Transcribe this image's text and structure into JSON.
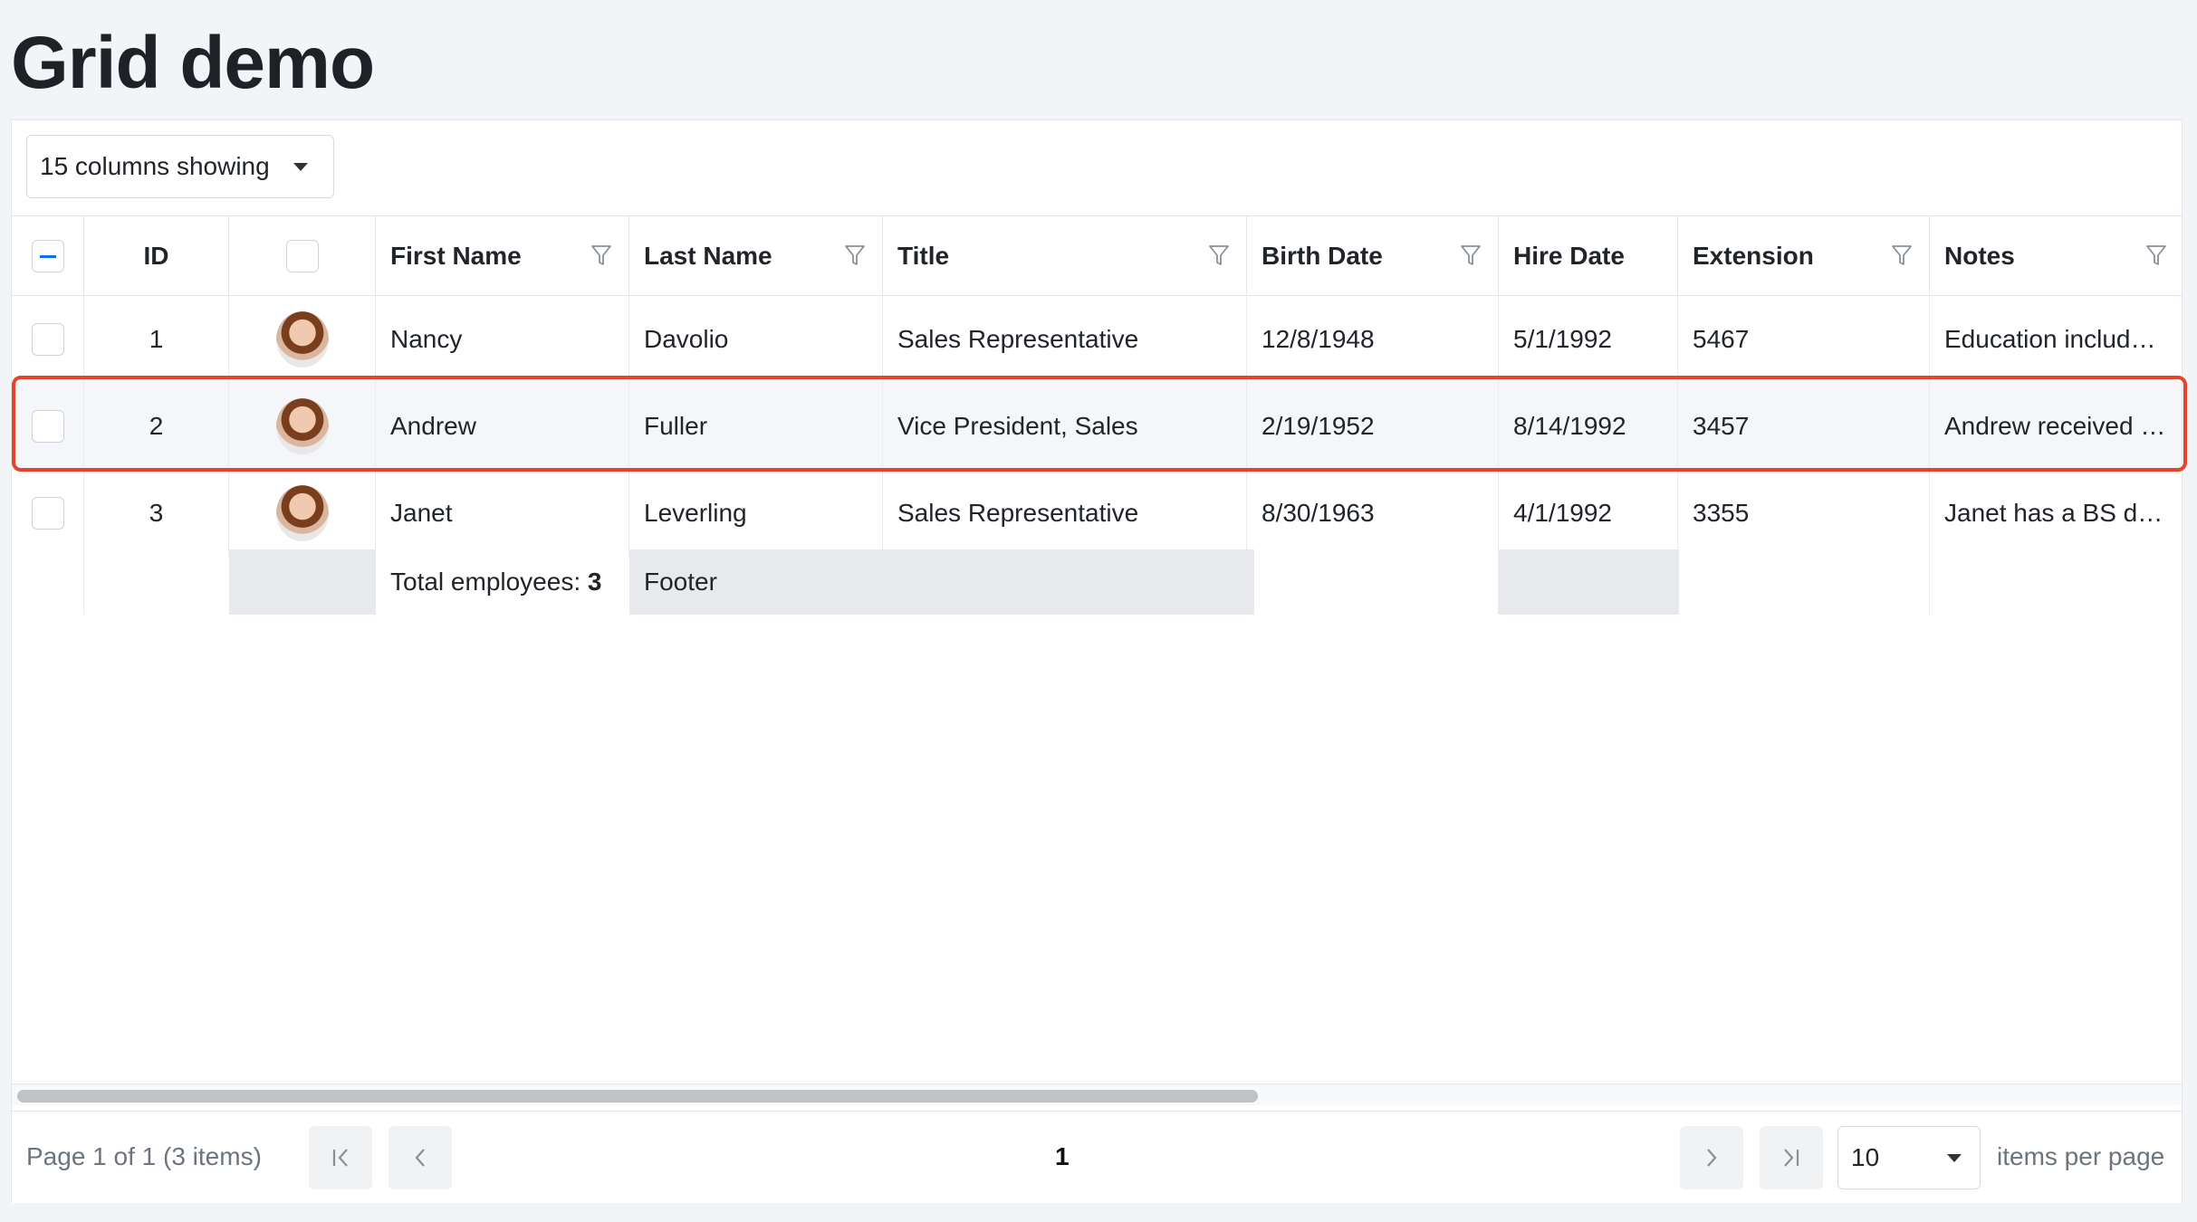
{
  "page": {
    "title": "Grid demo"
  },
  "toolbar": {
    "column_chooser_label": "15 columns showing"
  },
  "columns": {
    "id": "ID",
    "first_name": "First Name",
    "last_name": "Last Name",
    "title": "Title",
    "birth_date": "Birth Date",
    "hire_date": "Hire Date",
    "extension": "Extension",
    "notes": "Notes"
  },
  "rows": [
    {
      "id": "1",
      "first_name": "Nancy",
      "last_name": "Davolio",
      "title": "Sales Representative",
      "birth_date": "12/8/1948",
      "hire_date": "5/1/1992",
      "extension": "5467",
      "notes": "Education includ…"
    },
    {
      "id": "2",
      "first_name": "Andrew",
      "last_name": "Fuller",
      "title": "Vice President, Sales",
      "birth_date": "2/19/1952",
      "hire_date": "8/14/1992",
      "extension": "3457",
      "notes": "Andrew received …"
    },
    {
      "id": "3",
      "first_name": "Janet",
      "last_name": "Leverling",
      "title": "Sales Representative",
      "birth_date": "8/30/1963",
      "hire_date": "4/1/1992",
      "extension": "3355",
      "notes": "Janet has a BS d…"
    }
  ],
  "footer": {
    "total_label": "Total employees: ",
    "total_count": "3",
    "last_name_footer": "Footer"
  },
  "pager": {
    "info": "Page 1 of 1 (3 items)",
    "current_page": "1",
    "page_size": "10",
    "items_per_page_label": "items per page"
  },
  "colors": {
    "highlight_border": "#e5432d",
    "accent": "#0d6efd"
  },
  "icons": {
    "filter": "filter-icon",
    "dropdown": "chevron-down-icon",
    "first_page": "first-page-icon",
    "prev_page": "prev-page-icon",
    "next_page": "next-page-icon",
    "last_page": "last-page-icon"
  }
}
